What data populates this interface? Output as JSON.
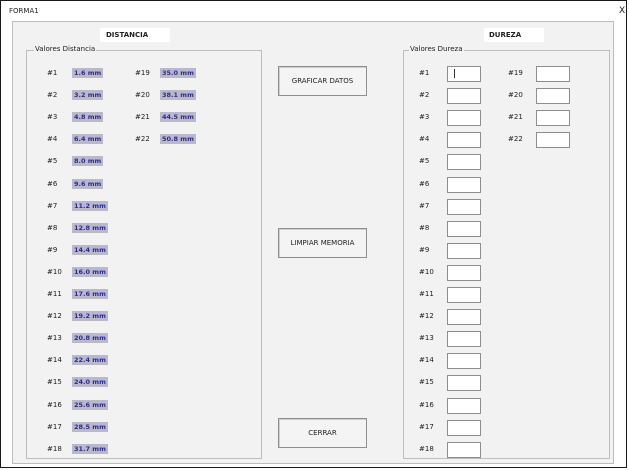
{
  "window": {
    "title": "FORMA1",
    "close_glyph": "X"
  },
  "distancia": {
    "header": "DISTANCIA",
    "group_title": "Valores Distancia",
    "items": [
      {
        "label": "#1",
        "value": "1.6 mm"
      },
      {
        "label": "#2",
        "value": "3.2 mm"
      },
      {
        "label": "#3",
        "value": "4.8 mm"
      },
      {
        "label": "#4",
        "value": "6.4 mm"
      },
      {
        "label": "#5",
        "value": "8.0 mm"
      },
      {
        "label": "#6",
        "value": "9.6 mm"
      },
      {
        "label": "#7",
        "value": "11.2 mm"
      },
      {
        "label": "#8",
        "value": "12.8 mm"
      },
      {
        "label": "#9",
        "value": "14.4 mm"
      },
      {
        "label": "#10",
        "value": "16.0 mm"
      },
      {
        "label": "#11",
        "value": "17.6 mm"
      },
      {
        "label": "#12",
        "value": "19.2 mm"
      },
      {
        "label": "#13",
        "value": "20.8 mm"
      },
      {
        "label": "#14",
        "value": "22.4 mm"
      },
      {
        "label": "#15",
        "value": "24.0 mm"
      },
      {
        "label": "#16",
        "value": "25.6 mm"
      },
      {
        "label": "#17",
        "value": "28.5 mm"
      },
      {
        "label": "#18",
        "value": "31.7 mm"
      },
      {
        "label": "#19",
        "value": "35.0 mm"
      },
      {
        "label": "#20",
        "value": "38.1 mm"
      },
      {
        "label": "#21",
        "value": "44.5 mm"
      },
      {
        "label": "#22",
        "value": "50.8 mm"
      }
    ]
  },
  "dureza": {
    "header": "DUREZA",
    "group_title": "Valores Dureza",
    "items": [
      {
        "label": "#1",
        "value": ""
      },
      {
        "label": "#2",
        "value": ""
      },
      {
        "label": "#3",
        "value": ""
      },
      {
        "label": "#4",
        "value": ""
      },
      {
        "label": "#5",
        "value": ""
      },
      {
        "label": "#6",
        "value": ""
      },
      {
        "label": "#7",
        "value": ""
      },
      {
        "label": "#8",
        "value": ""
      },
      {
        "label": "#9",
        "value": ""
      },
      {
        "label": "#10",
        "value": ""
      },
      {
        "label": "#11",
        "value": ""
      },
      {
        "label": "#12",
        "value": ""
      },
      {
        "label": "#13",
        "value": ""
      },
      {
        "label": "#14",
        "value": ""
      },
      {
        "label": "#15",
        "value": ""
      },
      {
        "label": "#16",
        "value": ""
      },
      {
        "label": "#17",
        "value": ""
      },
      {
        "label": "#18",
        "value": ""
      },
      {
        "label": "#19",
        "value": ""
      },
      {
        "label": "#20",
        "value": ""
      },
      {
        "label": "#21",
        "value": ""
      },
      {
        "label": "#22",
        "value": ""
      }
    ]
  },
  "buttons": {
    "graficar": "GRAFICAR DATOS",
    "limpiar": "LIMPIAR MEMORIA",
    "cerrar": "CERRAR"
  },
  "colors": {
    "value_bg": "#b9b9c9",
    "value_text": "#2b2b9a",
    "form_bg": "#f2f2f2"
  }
}
